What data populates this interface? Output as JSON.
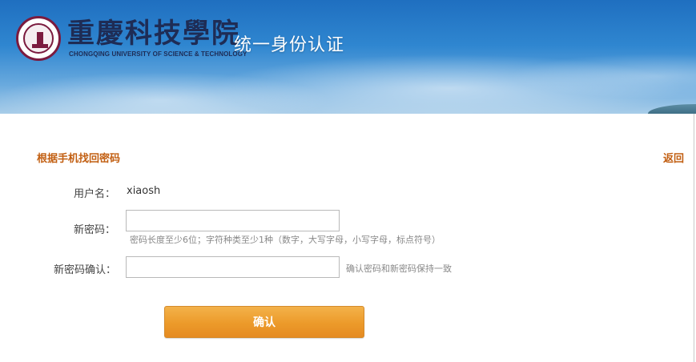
{
  "header": {
    "school_name_cn": "重慶科技學院",
    "school_name_en": "CHONGQING UNIVERSITY OF SCIENCE & TECHNOLOGY",
    "system_title": "统一身份认证"
  },
  "page": {
    "section_title": "根据手机找回密码",
    "back_label": "返回"
  },
  "form": {
    "username_label": "用户名：",
    "username_value": "xiaosh",
    "new_password_label": "新密码：",
    "new_password_value": "",
    "new_password_hint": "密码长度至少6位；字符种类至少1种（数字，大写字母，小写字母，标点符号）",
    "confirm_password_label": "新密码确认：",
    "confirm_password_value": "",
    "confirm_password_hint": "确认密码和新密码保持一致",
    "submit_label": "确认"
  },
  "colors": {
    "accent": "#c25f12",
    "button": "#ec9a2a",
    "banner": "#2f86d0"
  }
}
